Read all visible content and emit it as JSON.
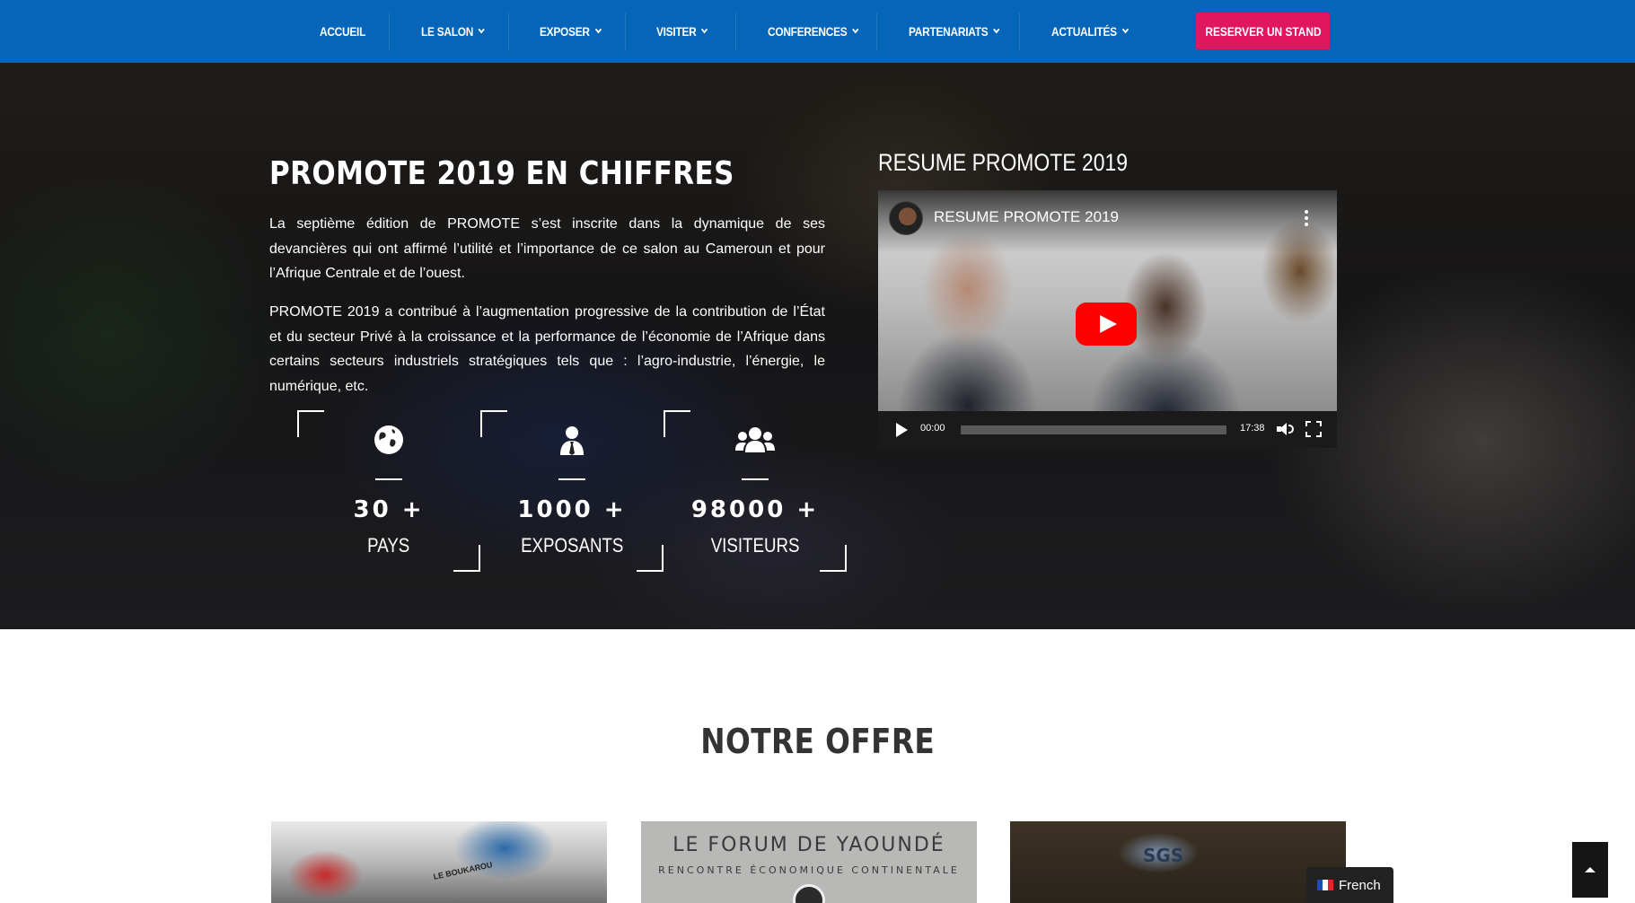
{
  "nav": {
    "items": [
      {
        "label": "ACCUEIL",
        "dropdown": false
      },
      {
        "label": "LE SALON",
        "dropdown": true
      },
      {
        "label": "EXPOSER",
        "dropdown": true
      },
      {
        "label": "VISITER",
        "dropdown": true
      },
      {
        "label": "CONFERENCES",
        "dropdown": true
      },
      {
        "label": "PARTENARIATS",
        "dropdown": true
      },
      {
        "label": "ACTUALITÉS",
        "dropdown": true
      }
    ],
    "cta_label": "RESERVER UN STAND",
    "colors": {
      "bar": "#0565b8",
      "cta": "#e0165f"
    }
  },
  "hero": {
    "title": "PROMOTE 2019 EN CHIFFRES",
    "paragraph_1": "La septième édition de PROMOTE s’est inscrite dans la dynamique de ses devancières qui ont affirmé l’utilité et l’importance de ce salon au Cameroun et pour l’Afrique Centrale et de l’ouest.",
    "paragraph_2": "PROMOTE 2019 a contribué à l’augmentation progressive de la contribution de l’État et du secteur Privé à la croissance et la performance de l’économie de l’Afrique dans certains secteurs industriels stratégiques tels que : l’agro-industrie, l’énergie, le numérique, etc.",
    "stats": [
      {
        "icon": "globe-icon",
        "number": "30 +",
        "label": "PAYS"
      },
      {
        "icon": "businessman-icon",
        "number": "1000 +",
        "label": "EXPOSANTS"
      },
      {
        "icon": "users-group-icon",
        "number": "98000 +",
        "label": "VISITEURS"
      }
    ]
  },
  "video": {
    "heading": "RESUME PROMOTE 2019",
    "youtube_title": "RESUME PROMOTE 2019",
    "current_time": "00:00",
    "duration": "17:38",
    "progress": 0
  },
  "offre": {
    "title": "NOTRE OFFRE",
    "cards": [
      {
        "name": "stand",
        "text": "LE BOUKAROU"
      },
      {
        "name": "forum",
        "title": "LE FORUM DE YAOUNDÉ",
        "subtitle": "RENCONTRE ÉCONOMIQUE CONTINENTALE"
      },
      {
        "name": "conference",
        "text": "SGS"
      }
    ]
  },
  "language": {
    "label": "French",
    "flag": "france-flag-icon"
  }
}
